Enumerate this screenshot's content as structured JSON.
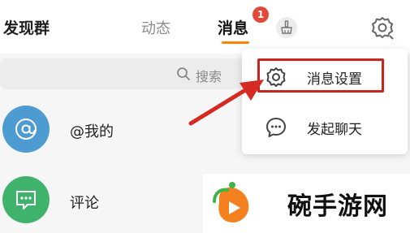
{
  "header": {
    "discover_label": "发现群",
    "tabs": [
      {
        "label": "动态",
        "active": false
      },
      {
        "label": "消息",
        "active": true,
        "badge": "1"
      }
    ],
    "active_color": "#ff8200",
    "badge_color": "#e14a3b"
  },
  "search": {
    "placeholder": "搜索"
  },
  "list": [
    {
      "label": "@我的",
      "icon": "at-icon",
      "avatar_color": "#4d9bd1"
    },
    {
      "label": "评论",
      "icon": "comment-icon",
      "avatar_color": "#3fb36b"
    }
  ],
  "menu": {
    "items": [
      {
        "label": "消息设置",
        "icon": "gear-icon",
        "highlighted": true
      },
      {
        "label": "发起聊天",
        "icon": "chat-bubble-icon",
        "highlighted": false
      }
    ],
    "highlight_color": "#c8251f"
  },
  "watermark": {
    "text": "碗手游网"
  }
}
